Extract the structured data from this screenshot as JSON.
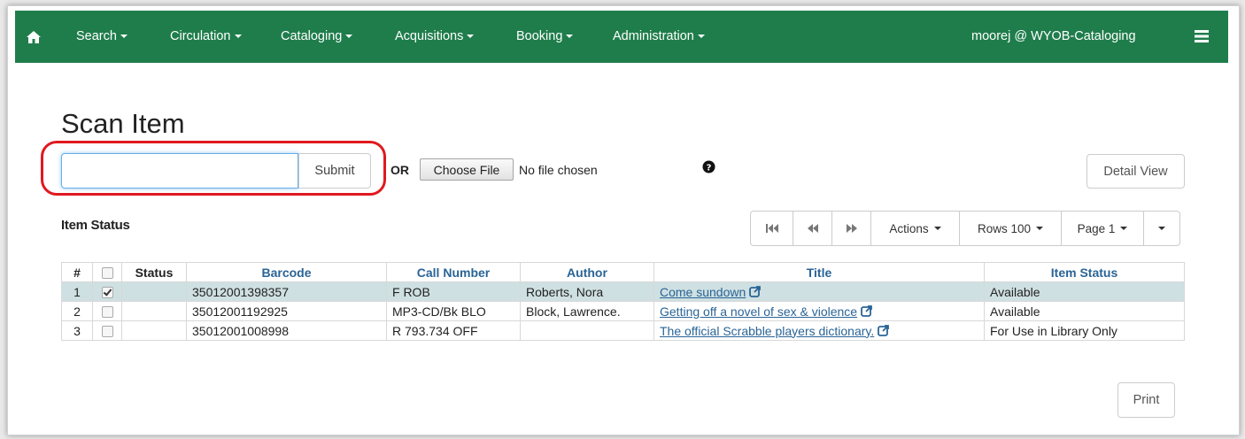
{
  "navbar": {
    "home_icon": "home-icon",
    "items": [
      "Search",
      "Circulation",
      "Cataloging",
      "Acquisitions",
      "Booking",
      "Administration"
    ],
    "user": "moorej @ WYOB-Cataloging",
    "menu_icon": "list-menu-icon",
    "color": "#1f7d4c"
  },
  "page": {
    "title": "Scan Item"
  },
  "scan": {
    "input_value": "",
    "submit_label": "Submit",
    "or_label": "OR",
    "choose_file_label": "Choose File",
    "file_status": "No file chosen",
    "help_icon": "question-circle-icon",
    "detail_view_label": "Detail View",
    "highlight_color": "#e0191f"
  },
  "item_status": {
    "title": "Item Status",
    "pager": {
      "first_icon": "first-page-icon",
      "prev_icon": "previous-page-icon",
      "next_icon": "next-page-icon",
      "actions_label": "Actions",
      "rows_label": "Rows 100",
      "page_label": "Page 1"
    },
    "columns": [
      "#",
      "",
      "Status",
      "Barcode",
      "Call Number",
      "Author",
      "Title",
      "Item Status"
    ],
    "rows": [
      {
        "num": "1",
        "checked": true,
        "status": "",
        "barcode": "35012001398357",
        "call_number": "F ROB",
        "author": "Roberts, Nora",
        "title": "Come sundown",
        "item_status": "Available"
      },
      {
        "num": "2",
        "checked": false,
        "status": "",
        "barcode": "35012001192925",
        "call_number": "MP3-CD/Bk BLO",
        "author": "Block, Lawrence.",
        "title": "Getting off a novel of sex & violence",
        "item_status": "Available"
      },
      {
        "num": "3",
        "checked": false,
        "status": "",
        "barcode": "35012001008998",
        "call_number": "R 793.734 OFF",
        "author": "",
        "title": "The official Scrabble players dictionary.",
        "item_status": "For Use in Library Only"
      }
    ],
    "selected_row_color": "#cfe0e2"
  },
  "footer": {
    "print_label": "Print"
  }
}
